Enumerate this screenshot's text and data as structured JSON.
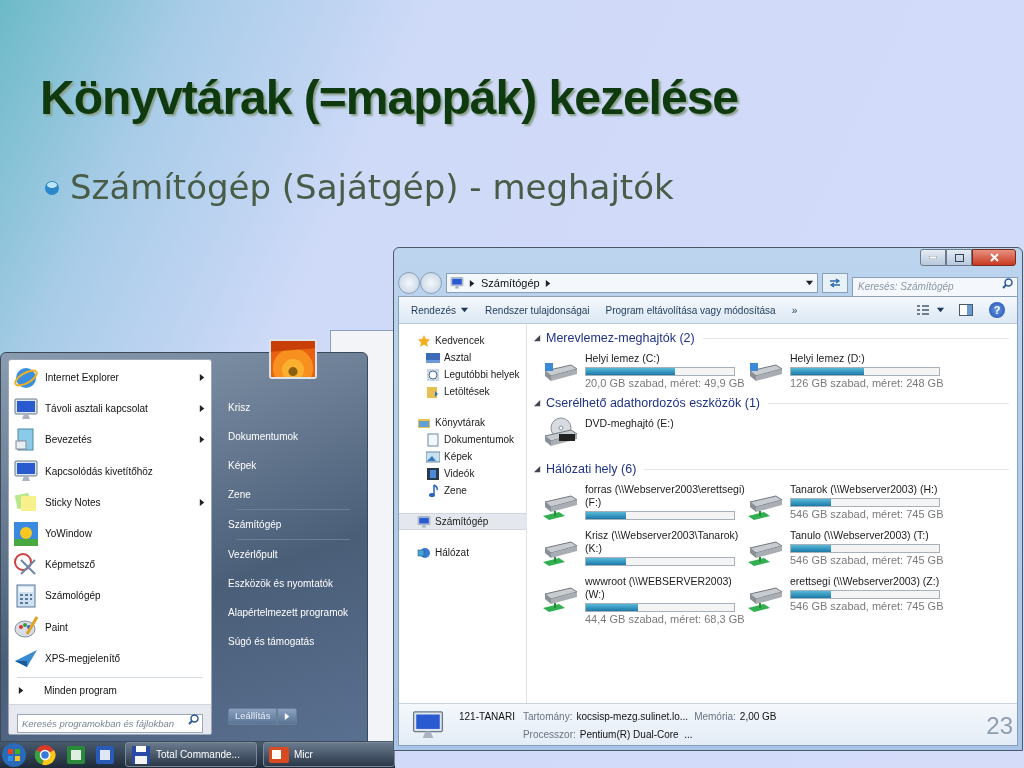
{
  "slide": {
    "title": "Könyvtárak (=mappák) kezelése",
    "bullet": "Számítógép (Sajátgép) - meghajtók",
    "page_number": "23"
  },
  "start_menu": {
    "programs": [
      {
        "label": "Internet Explorer",
        "submenu": true
      },
      {
        "label": "Távoli asztali kapcsolat",
        "submenu": true
      },
      {
        "label": "Bevezetés",
        "submenu": true
      },
      {
        "label": "Kapcsolódás kivetítőhöz",
        "submenu": false
      },
      {
        "label": "Sticky Notes",
        "submenu": true
      },
      {
        "label": "YoWindow",
        "submenu": false
      },
      {
        "label": "Képmetsző",
        "submenu": false
      },
      {
        "label": "Számológép",
        "submenu": false
      },
      {
        "label": "Paint",
        "submenu": false
      },
      {
        "label": "XPS-megjelenítő",
        "submenu": false
      }
    ],
    "all_programs": "Minden program",
    "search": {
      "placeholder": "Keresés programokban és fájlokban"
    },
    "place_groups": [
      [
        "Krisz",
        "Dokumentumok",
        "Képek",
        "Zene"
      ],
      [
        "Számítógép"
      ],
      [
        "Vezérlőpult",
        "Eszközök és nyomtatók",
        "Alapértelmezett programok",
        "Súgó és támogatás"
      ]
    ],
    "shutdown": "Leállítás"
  },
  "taskbar": {
    "windows": [
      {
        "label": "Total Commande..."
      },
      {
        "label": "Micr"
      }
    ]
  },
  "explorer": {
    "address": "Számítógép",
    "search": {
      "placeholder": "Keresés: Számítógép"
    },
    "toolbar": [
      {
        "kind": "menu",
        "label": "Rendezés"
      },
      {
        "kind": "button",
        "label": "Rendszer tulajdonságai"
      },
      {
        "kind": "button",
        "label": "Program eltávolítása vagy módosítása"
      },
      {
        "kind": "button",
        "label": "»"
      }
    ],
    "help": "?",
    "nav": [
      {
        "label": "Kedvencek",
        "selected": false,
        "children": [
          {
            "label": "Asztal",
            "selected": false
          },
          {
            "label": "Legutóbbi helyek",
            "selected": false
          },
          {
            "label": "Letöltések",
            "selected": false
          }
        ]
      },
      {
        "label": "Könyvtárak",
        "selected": false,
        "children": [
          {
            "label": "Dokumentumok",
            "selected": false
          },
          {
            "label": "Képek",
            "selected": false
          },
          {
            "label": "Videók",
            "selected": false
          },
          {
            "label": "Zene",
            "selected": false
          }
        ]
      },
      {
        "label": "Számítógép",
        "selected": true
      },
      {
        "label": "Hálózat",
        "selected": false
      }
    ],
    "sections": [
      {
        "title": "Merevlemez-meghajtók (2)",
        "drives": [
          {
            "kind": "disk",
            "name": "Helyi lemez (C:)",
            "level": 0.6,
            "space": "20,0 GB szabad, méret: 49,9 GB"
          },
          {
            "kind": "disk",
            "name": "Helyi lemez (D:)",
            "level": 0.49,
            "space": "126 GB szabad, méret: 248 GB"
          }
        ]
      },
      {
        "title": "Cserélhető adathordozós eszközök (1)",
        "drives": [
          {
            "kind": "dvd",
            "name": "DVD-meghajtó (E:)"
          }
        ]
      },
      {
        "title": "Hálózati hely (6)",
        "drives": [
          {
            "kind": "network",
            "name": "forras (\\\\Webserver2003\\erettsegi) (F:)",
            "level": 0.27
          },
          {
            "kind": "network",
            "name": "Tanarok (\\\\Webserver2003) (H:)",
            "level": 0.27,
            "space": "546 GB szabad, méret: 745 GB"
          },
          {
            "kind": "network",
            "name": "Krisz (\\\\Webserver2003\\Tanarok) (K:)",
            "level": 0.27
          },
          {
            "kind": "network",
            "name": "Tanulo (\\\\Webserver2003) (T:)",
            "level": 0.27,
            "space": "546 GB szabad, méret: 745 GB"
          },
          {
            "kind": "network",
            "name": "wwwroot (\\\\WEBSERVER2003) (W:)",
            "level": 0.35,
            "space": "44,4 GB szabad, méret: 68,3 GB"
          },
          {
            "kind": "network",
            "name": "erettsegi (\\\\Webserver2003) (Z:)",
            "level": 0.27,
            "space": "546 GB szabad, méret: 745 GB"
          }
        ]
      }
    ],
    "details": {
      "computer": "121-TANARI",
      "rows": [
        [
          {
            "label": "Tartomány:",
            "value": "kocsisp-mezg.sulinet.lo..."
          },
          {
            "label": "Memória:",
            "value": "2,00 GB"
          }
        ],
        [
          {
            "label": "Processzor:",
            "value": "Pentium(R) Dual-Core  ..."
          }
        ]
      ]
    }
  }
}
